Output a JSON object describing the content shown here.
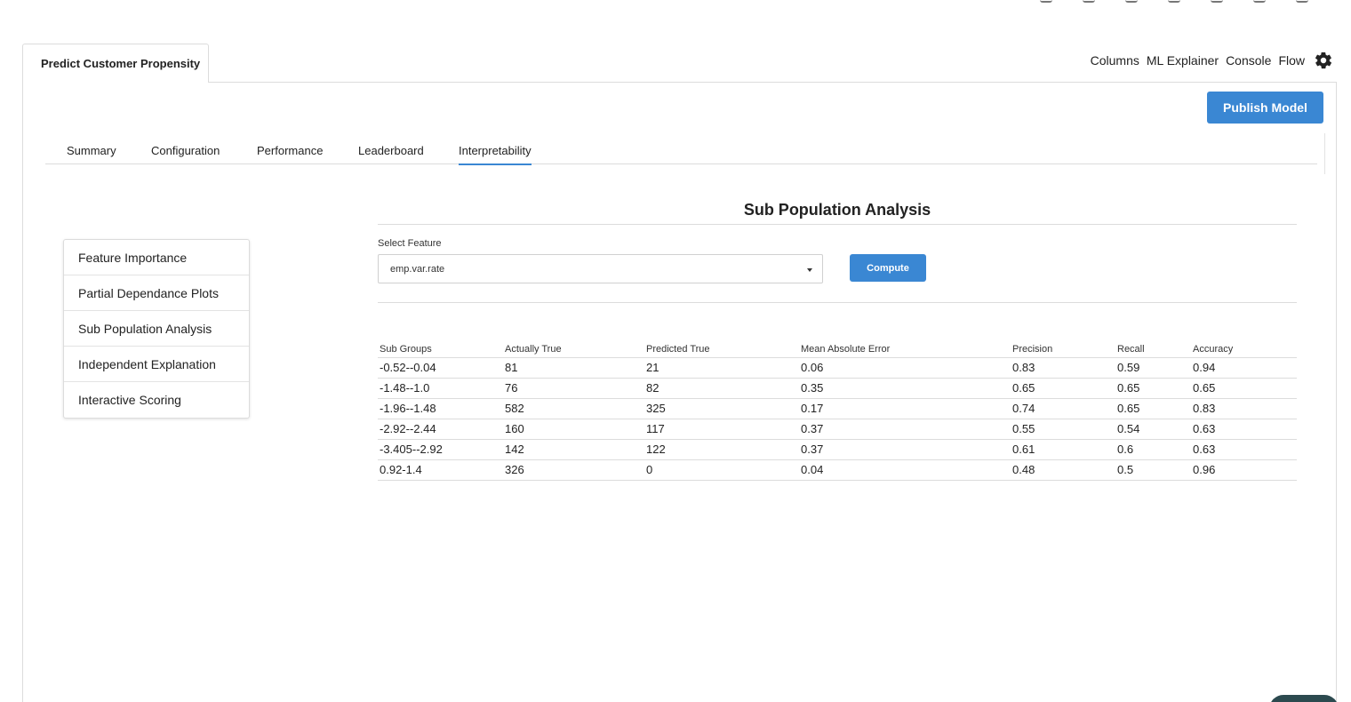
{
  "app_tab": {
    "label": "Predict Customer Propensity"
  },
  "top_nav": {
    "items": [
      "Columns",
      "ML Explainer",
      "Console",
      "Flow"
    ],
    "settings_icon": "gear-icon"
  },
  "publish_button": {
    "label": "Publish Model"
  },
  "subtabs": [
    {
      "label": "Summary",
      "active": false
    },
    {
      "label": "Configuration",
      "active": false
    },
    {
      "label": "Performance",
      "active": false
    },
    {
      "label": "Leaderboard",
      "active": false
    },
    {
      "label": "Interpretability",
      "active": true
    }
  ],
  "side_menu": [
    "Feature Importance",
    "Partial Dependance Plots",
    "Sub Population Analysis",
    "Independent Explanation",
    "Interactive Scoring"
  ],
  "content": {
    "title": "Sub Population Analysis",
    "select_label": "Select Feature",
    "select_value": "emp.var.rate",
    "compute_label": "Compute"
  },
  "table": {
    "columns": [
      "Sub Groups",
      "Actually True",
      "Predicted True",
      "Mean Absolute Error",
      "Precision",
      "Recall",
      "Accuracy"
    ],
    "rows": [
      [
        "-0.52--0.04",
        "81",
        "21",
        "0.06",
        "0.83",
        "0.59",
        "0.94"
      ],
      [
        "-1.48--1.0",
        "76",
        "82",
        "0.35",
        "0.65",
        "0.65",
        "0.65"
      ],
      [
        "-1.96--1.48",
        "582",
        "325",
        "0.17",
        "0.74",
        "0.65",
        "0.83"
      ],
      [
        "-2.92--2.44",
        "160",
        "117",
        "0.37",
        "0.55",
        "0.54",
        "0.63"
      ],
      [
        "-3.405--2.92",
        "142",
        "122",
        "0.37",
        "0.61",
        "0.6",
        "0.63"
      ],
      [
        "0.92-1.4",
        "326",
        "0",
        "0.04",
        "0.48",
        "0.5",
        "0.96"
      ]
    ]
  },
  "colors": {
    "accent": "#3a87d3",
    "border": "#dcdcdc"
  }
}
